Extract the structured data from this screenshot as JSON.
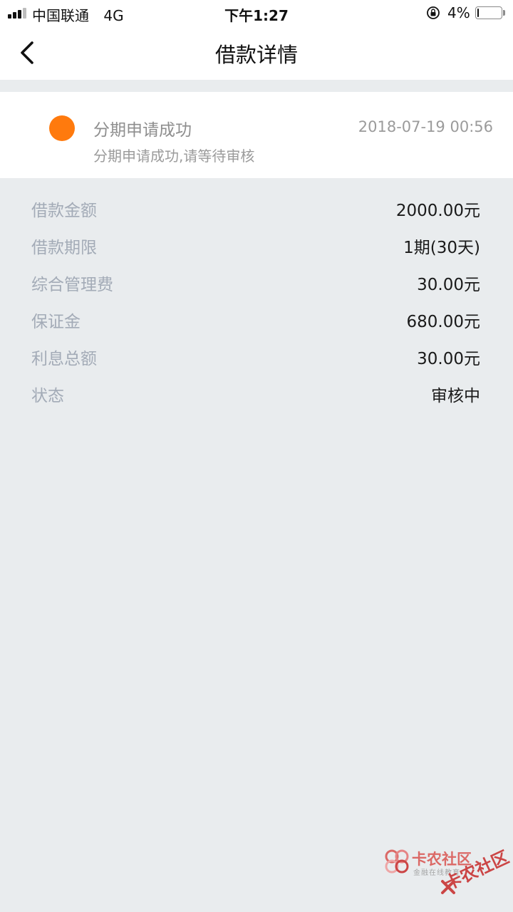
{
  "status_bar": {
    "carrier": "中国联通",
    "network": "4G",
    "time": "下午1:27",
    "battery_percent": "4%",
    "battery_level": 0.04
  },
  "nav": {
    "title": "借款详情",
    "back_icon": "chevron-left-icon"
  },
  "status_card": {
    "dot_color": "#ff7a0d",
    "title": "分期申请成功",
    "timestamp": "2018-07-19 00:56",
    "description": "分期申请成功,请等待审核"
  },
  "details": [
    {
      "label": "借款金额",
      "value": "2000.00元"
    },
    {
      "label": "借款期限",
      "value": "1期(30天)"
    },
    {
      "label": "综合管理费",
      "value": "30.00元"
    },
    {
      "label": "保证金",
      "value": "680.00元"
    },
    {
      "label": "利息总额",
      "value": "30.00元"
    },
    {
      "label": "状态",
      "value": "审核中"
    }
  ],
  "watermark": {
    "title": "卡农社区",
    "subtitle": "金融在线教育",
    "stamp": "卡农社区",
    "color": "#d9534f"
  }
}
